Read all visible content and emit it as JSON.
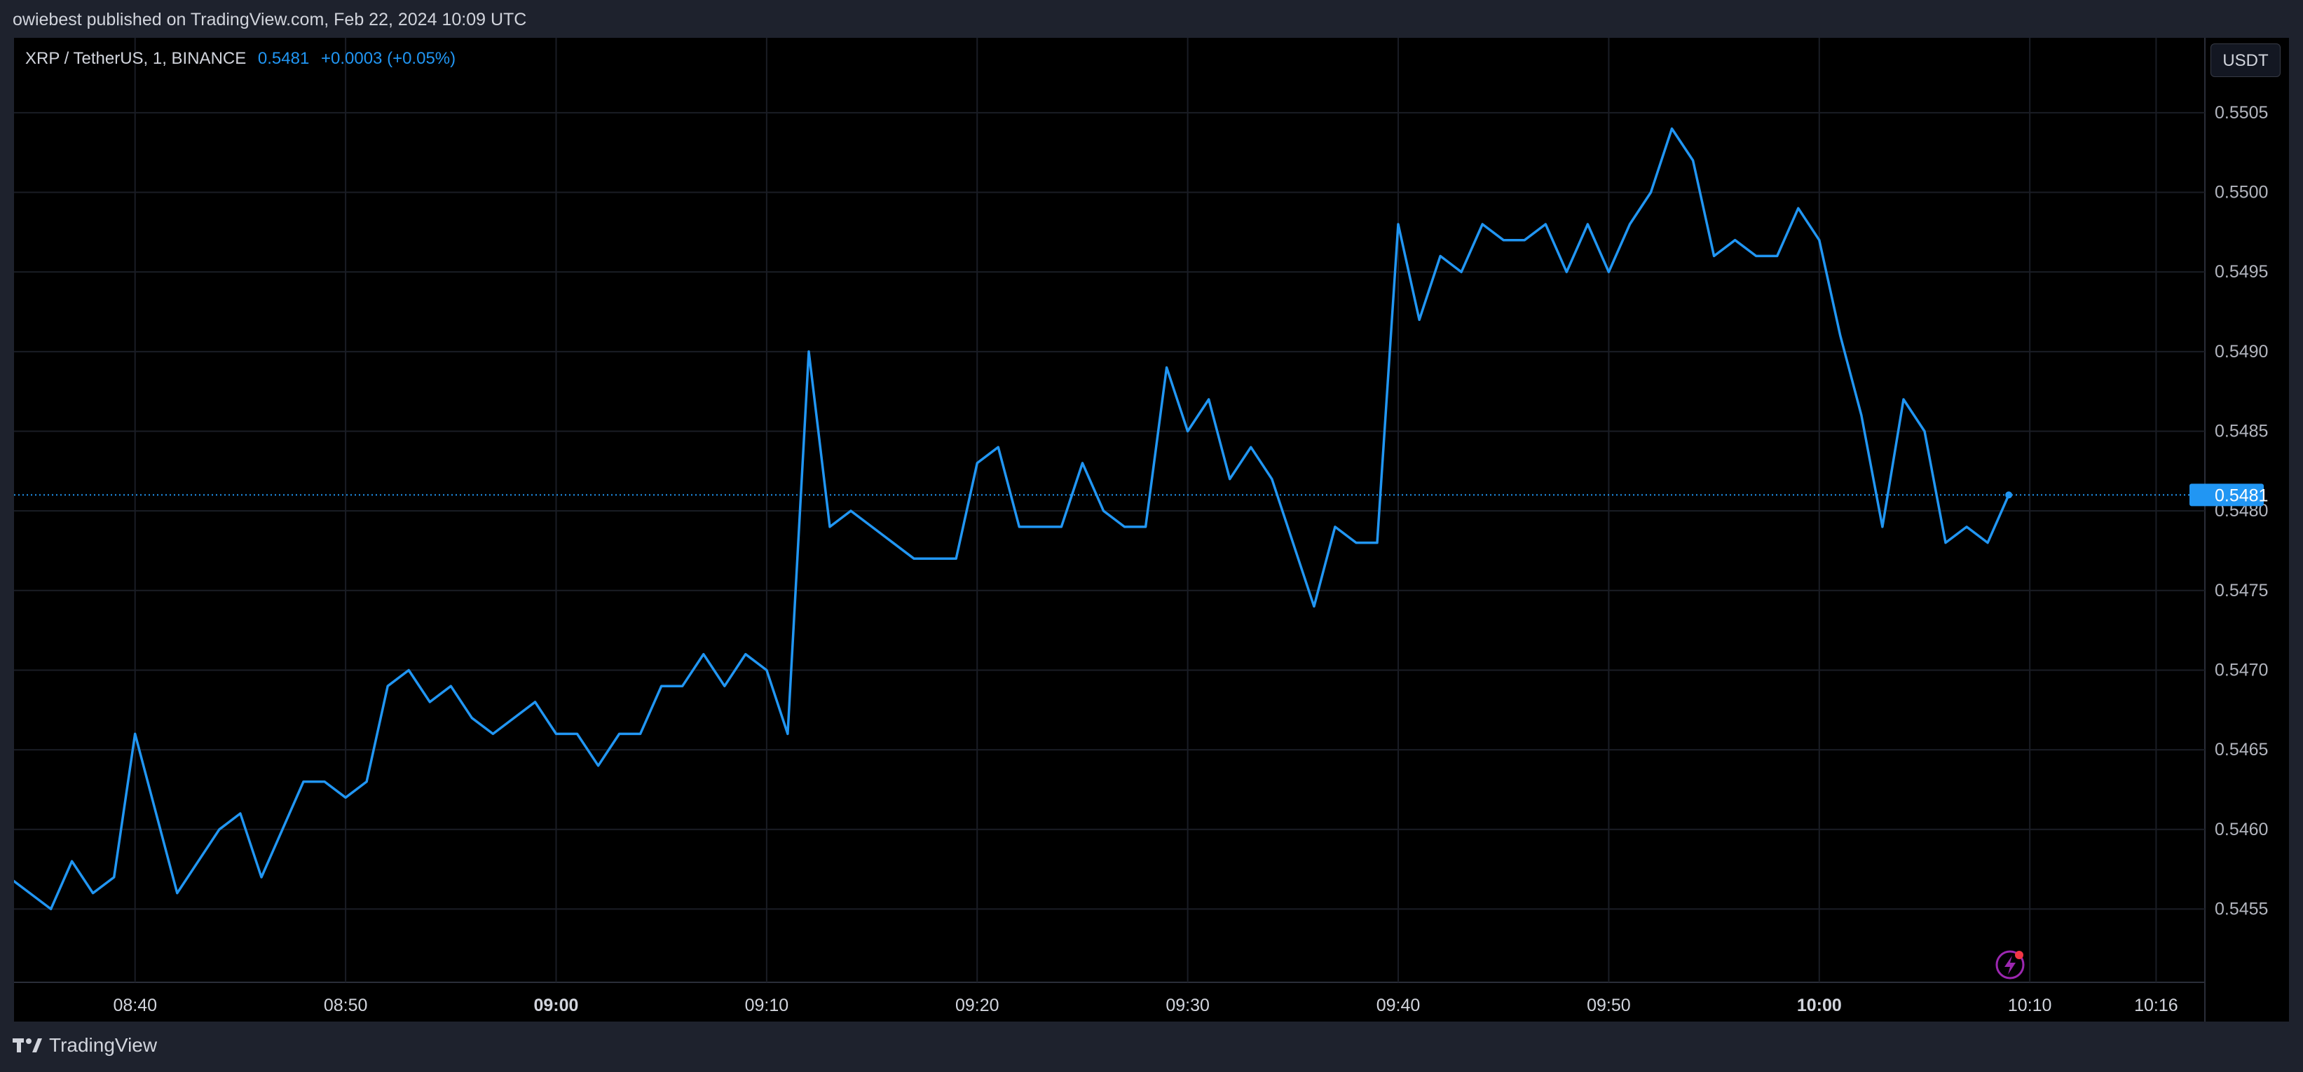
{
  "caption": "owiebest published on TradingView.com, Feb 22, 2024 10:09 UTC",
  "legend": {
    "symbol": "XRP / TetherUS, 1, BINANCE",
    "price": "0.5481",
    "change": "+0.0003 (+0.05%)"
  },
  "currency_button": "USDT",
  "footer": {
    "brand": "TradingView",
    "logo_icon": "tradingview-logo-icon"
  },
  "alert_icon": "lightning-alert-icon",
  "colors": {
    "line": "#2196f3",
    "last_price_label": "#2196f3",
    "grid": "#1a1d25",
    "background": "#000000",
    "alert": "#9c27b0"
  },
  "chart_data": {
    "type": "line",
    "title": "XRP / TetherUS, 1, BINANCE",
    "xlabel": "",
    "ylabel": "",
    "ylim": [
      0.54504,
      0.55097
    ],
    "xlim": [
      "08:34:15",
      "10:18:15"
    ],
    "grid": true,
    "y_ticks": [
      "0.5505",
      "0.5500",
      "0.5495",
      "0.5490",
      "0.5485",
      "0.5480",
      "0.5475",
      "0.5470",
      "0.5465",
      "0.5460",
      "0.5455"
    ],
    "x_ticks": [
      {
        "time": "08:40",
        "label": "08:40",
        "bold": false
      },
      {
        "time": "08:50",
        "label": "08:50",
        "bold": false
      },
      {
        "time": "09:00",
        "label": "09:00",
        "bold": true
      },
      {
        "time": "09:10",
        "label": "09:10",
        "bold": false
      },
      {
        "time": "09:20",
        "label": "09:20",
        "bold": false
      },
      {
        "time": "09:30",
        "label": "09:30",
        "bold": false
      },
      {
        "time": "09:40",
        "label": "09:40",
        "bold": false
      },
      {
        "time": "09:50",
        "label": "09:50",
        "bold": false
      },
      {
        "time": "10:00",
        "label": "10:00",
        "bold": true
      },
      {
        "time": "10:10",
        "label": "10:10",
        "bold": false
      },
      {
        "time": "10:16",
        "label": "10:16",
        "bold": false
      }
    ],
    "last_price": 0.5481,
    "last_price_label": "0.5481",
    "series": [
      {
        "x": [
          "08:34",
          "08:36",
          "08:37",
          "08:38",
          "08:39",
          "08:40",
          "08:42",
          "08:44",
          "08:45",
          "08:46",
          "08:48",
          "08:49",
          "08:50",
          "08:51",
          "08:52",
          "08:53",
          "08:54",
          "08:55",
          "08:56",
          "08:57",
          "08:59",
          "09:00",
          "09:01",
          "09:02",
          "09:03",
          "09:04",
          "09:05",
          "09:06",
          "09:07",
          "09:08",
          "09:09",
          "09:10",
          "09:11",
          "09:12",
          "09:13",
          "09:14",
          "09:15",
          "09:17",
          "09:19",
          "09:20",
          "09:21",
          "09:22",
          "09:24",
          "09:25",
          "09:26",
          "09:27",
          "09:28",
          "09:29",
          "09:30",
          "09:31",
          "09:32",
          "09:33",
          "09:34",
          "09:36",
          "09:37",
          "09:38",
          "09:39",
          "09:40",
          "09:41",
          "09:42",
          "09:43",
          "09:44",
          "09:45",
          "09:46",
          "09:47",
          "09:48",
          "09:49",
          "09:50",
          "09:51",
          "09:52",
          "09:53",
          "09:54",
          "09:55",
          "09:56",
          "09:57",
          "09:58",
          "09:59",
          "10:00",
          "10:01",
          "10:02",
          "10:03",
          "10:04",
          "10:05",
          "10:06",
          "10:07",
          "10:08",
          "10:09"
        ],
        "values": [
          0.5457,
          0.5455,
          0.5458,
          0.5456,
          0.5457,
          0.5466,
          0.5456,
          0.546,
          0.5461,
          0.5457,
          0.5463,
          0.5463,
          0.5462,
          0.5463,
          0.5469,
          0.547,
          0.5468,
          0.5469,
          0.5467,
          0.5466,
          0.5468,
          0.5466,
          0.5466,
          0.5464,
          0.5466,
          0.5466,
          0.5469,
          0.5469,
          0.5471,
          0.5469,
          0.5471,
          0.547,
          0.5466,
          0.549,
          0.5479,
          0.548,
          0.5479,
          0.5477,
          0.5477,
          0.5483,
          0.5484,
          0.5479,
          0.5479,
          0.5483,
          0.548,
          0.5479,
          0.5479,
          0.5489,
          0.5485,
          0.5487,
          0.5482,
          0.5484,
          0.5482,
          0.5474,
          0.5479,
          0.5478,
          0.5478,
          0.5498,
          0.5492,
          0.5496,
          0.5495,
          0.5498,
          0.5497,
          0.5497,
          0.5498,
          0.5495,
          0.5498,
          0.5495,
          0.5498,
          0.55,
          0.5504,
          0.5502,
          0.5496,
          0.5497,
          0.5496,
          0.5496,
          0.5499,
          0.5497,
          0.5491,
          0.5486,
          0.5479,
          0.5487,
          0.5485,
          0.5478,
          0.5479,
          0.5478,
          0.5481
        ]
      }
    ]
  }
}
